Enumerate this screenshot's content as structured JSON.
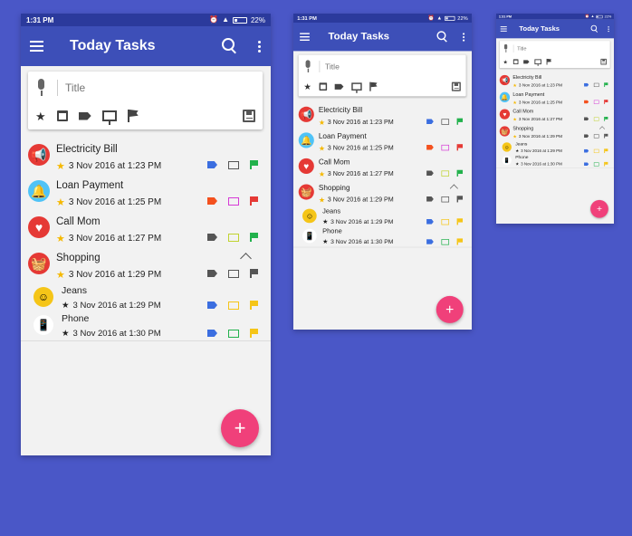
{
  "status": {
    "time": "1:31 PM",
    "battery": "22%"
  },
  "appbar": {
    "title": "Today Tasks"
  },
  "composer": {
    "placeholder": "Title"
  },
  "tasks": [
    {
      "name": "Electricity Bill",
      "date": "3  Nov  2016 at 1:23 PM",
      "avatar_color": "#e53935",
      "avatar_icon": "megaphone-icon",
      "colors": [
        "#3b6ee0",
        "#555555",
        "#22b14c"
      ]
    },
    {
      "name": "Loan Payment",
      "date": "3  Nov  2016 at 1:25 PM",
      "avatar_color": "#4fc3f7",
      "avatar_icon": "bell-icon",
      "colors": [
        "#f4511e",
        "#d63ad6",
        "#e53935"
      ]
    },
    {
      "name": "Call Mom",
      "date": "3  Nov  2016 at 1:27 PM",
      "avatar_color": "#e53935",
      "avatar_icon": "heart-icon",
      "colors": [
        "#555555",
        "#c0d330",
        "#22b14c"
      ]
    },
    {
      "name": "Shopping",
      "date": "3  Nov  2016 at 1:29 PM",
      "avatar_color": "#e53935",
      "avatar_icon": "basket-icon",
      "colors": [
        "#555555",
        "#555555",
        "#555555"
      ]
    }
  ],
  "subtasks": [
    {
      "name": "Jeans",
      "date": "3  Nov  2016 at 1:29 PM",
      "avatar_color": "#f5c518",
      "avatar_icon": "emoji-icon",
      "colors": [
        "#3b6ee0",
        "#f5c518",
        "#f5c518"
      ]
    },
    {
      "name": "Phone",
      "date": "3  Nov  2016 at 1:30 PM",
      "avatar_color": "#ffffff",
      "avatar_icon": "phone-icon",
      "colors": [
        "#3b6ee0",
        "#22b14c",
        "#f5c518"
      ]
    }
  ],
  "fab": {
    "label": "+"
  }
}
